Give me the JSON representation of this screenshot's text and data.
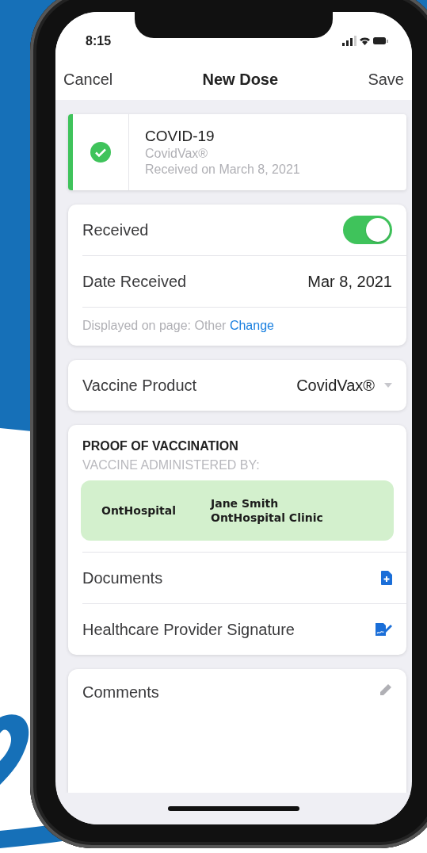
{
  "status_bar": {
    "time": "8:15"
  },
  "nav": {
    "cancel": "Cancel",
    "title": "New Dose",
    "save": "Save"
  },
  "dose": {
    "name": "COVID-19",
    "product": "CovidVax®",
    "received_note": "Received on March 8, 2021",
    "completed": true
  },
  "received": {
    "label": "Received",
    "on": true
  },
  "date": {
    "label": "Date Received",
    "value": "Mar 8, 2021"
  },
  "displayed": {
    "text": "Displayed on page: Other",
    "link": "Change"
  },
  "vaccine_product": {
    "label": "Vaccine Product",
    "value": "CovidVax®"
  },
  "proof": {
    "title": "PROOF OF VACCINATION",
    "subtitle": "VACCINE ADMINISTERED BY:",
    "organization": "OntHospital",
    "provider_name": "Jane Smith",
    "provider_clinic": "OntHospital Clinic"
  },
  "rows": [
    {
      "label": "Documents",
      "kind": "document"
    },
    {
      "label": "Healthcare Provider Signature",
      "kind": "signature"
    }
  ],
  "comments": {
    "label": "Comments"
  }
}
